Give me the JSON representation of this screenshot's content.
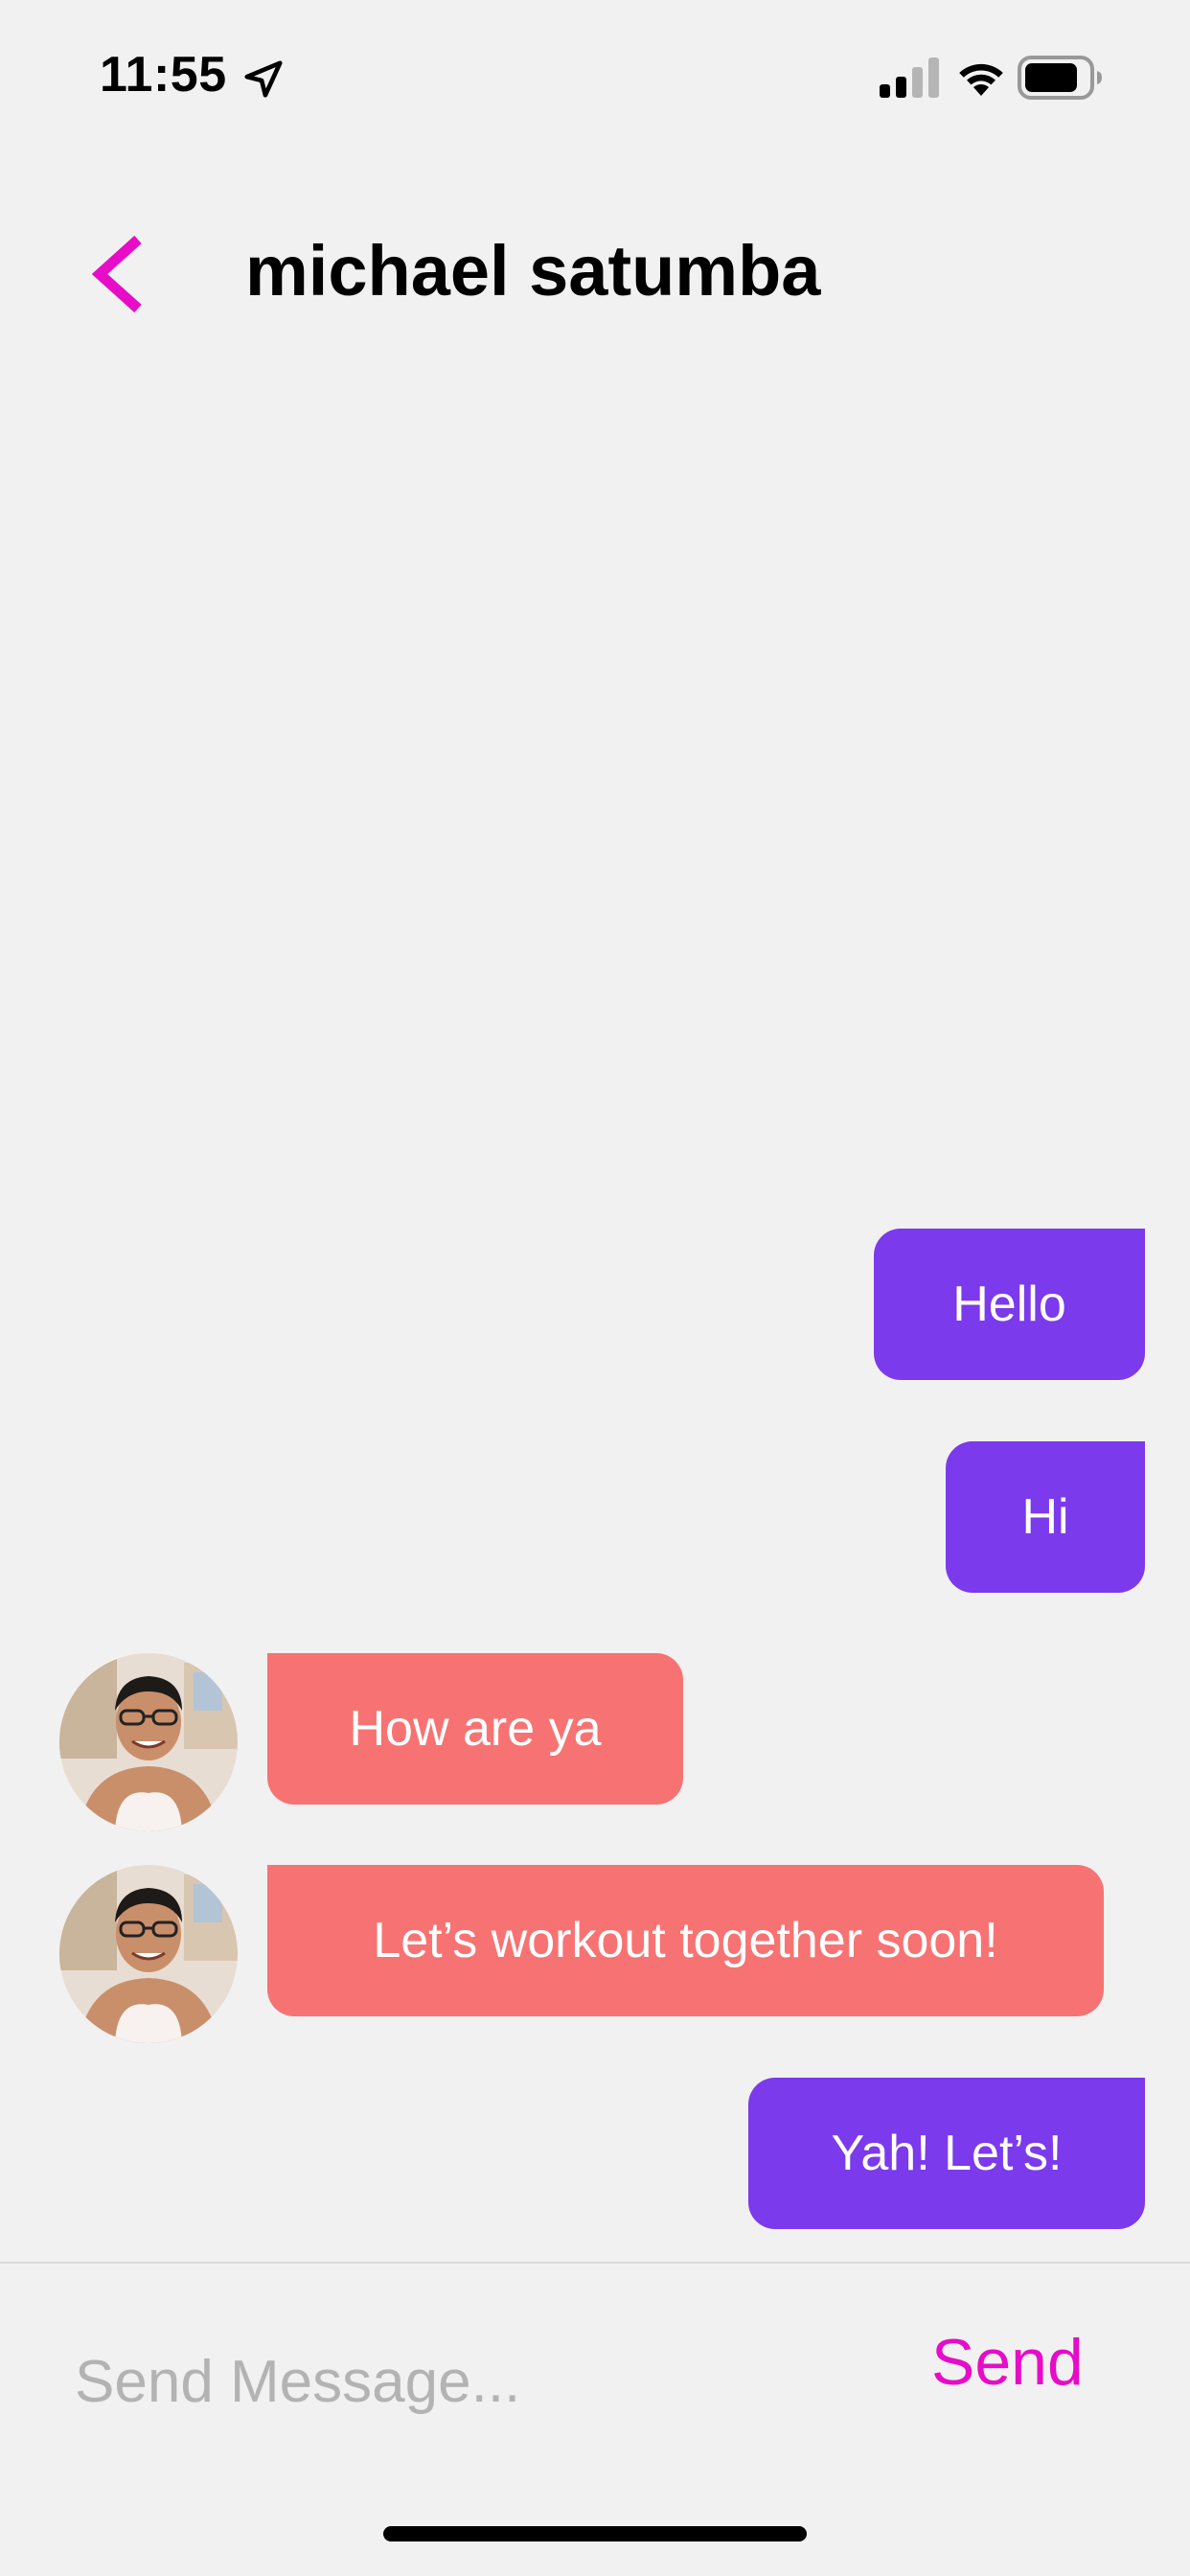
{
  "status_bar": {
    "time": "11:55",
    "icons": [
      "location-icon",
      "signal-icon",
      "wifi-icon",
      "battery-icon"
    ]
  },
  "header": {
    "title": "michael satumba",
    "back_icon": "chevron-left-icon",
    "accent_color": "#e60cc8"
  },
  "messages": [
    {
      "sender": "me",
      "text": "Hello"
    },
    {
      "sender": "me",
      "text": "Hi"
    },
    {
      "sender": "contact",
      "text": "How are ya"
    },
    {
      "sender": "contact",
      "text": "Let’s workout together soon!"
    },
    {
      "sender": "me",
      "text": "Yah! Let’s!"
    }
  ],
  "composer": {
    "placeholder": "Send Message...",
    "value": "",
    "send_label": "Send"
  },
  "colors": {
    "background": "#f2f1f2",
    "sent_bubble": "#7b3aec",
    "received_bubble": "#f77373",
    "accent": "#e60cc8"
  }
}
